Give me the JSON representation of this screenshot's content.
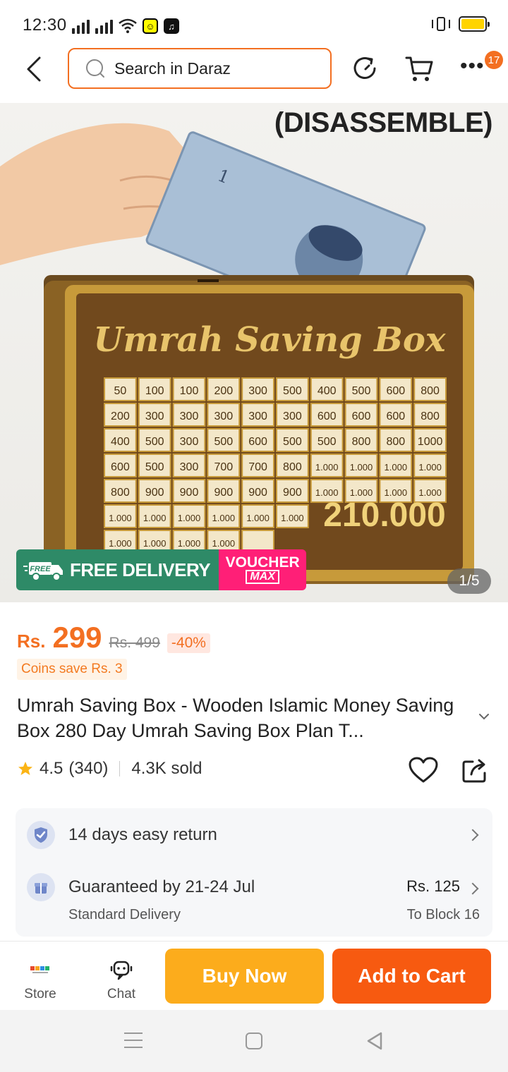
{
  "status_bar": {
    "time": "12:30"
  },
  "header": {
    "search_placeholder": "Search in Daraz",
    "cart_badge": "17"
  },
  "product_image": {
    "overlay_text": "(DISASSEMBLE)",
    "counter": "1/5",
    "promo_free_badge": "FREE",
    "promo_free_delivery": "FREE DELIVERY",
    "promo_voucher_line1": "VOUCHER",
    "promo_voucher_line2": "MAX",
    "box_title": "Umrah Saving Box",
    "box_total": "210.000",
    "box_grid": [
      [
        "50",
        "100",
        "100",
        "200",
        "300",
        "500",
        "400",
        "500",
        "600",
        "800"
      ],
      [
        "200",
        "300",
        "300",
        "300",
        "300",
        "300",
        "600",
        "600",
        "600",
        "800"
      ],
      [
        "400",
        "500",
        "300",
        "500",
        "600",
        "500",
        "500",
        "800",
        "800",
        "1000"
      ],
      [
        "600",
        "500",
        "300",
        "700",
        "700",
        "800",
        "1.000",
        "1.000",
        "1.000",
        "1.000"
      ],
      [
        "800",
        "900",
        "900",
        "900",
        "900",
        "900",
        "1.000",
        "1.000",
        "1.000",
        "1.000"
      ],
      [
        "1.000",
        "1.000",
        "1.000",
        "1.000",
        "1.000",
        "1.000"
      ],
      [
        "1.000",
        "1.000",
        "1.000",
        "1.000",
        ""
      ]
    ]
  },
  "price": {
    "currency": "Rs.",
    "current": "299",
    "original": "Rs. 499",
    "discount": "-40%",
    "coins": "Coins save Rs. 3"
  },
  "product": {
    "title": "Umrah Saving Box - Wooden Islamic Money Saving Box 280 Day Umrah Saving Box Plan T...",
    "rating": "4.5",
    "reviews": "(340)",
    "sold": "4.3K sold"
  },
  "delivery": {
    "return_text": "14 days easy return",
    "guarantee_text": "Guaranteed by 21-24 Jul",
    "delivery_type": "Standard Delivery",
    "delivery_price": "Rs. 125",
    "delivery_to": "To Block 16"
  },
  "actions": {
    "store": "Store",
    "chat": "Chat",
    "buy_now": "Buy Now",
    "add_to_cart": "Add to Cart"
  },
  "colors": {
    "brand": "#f36f21",
    "buy_now": "#fcac1c",
    "add_to_cart": "#f75a10",
    "free_delivery": "#2e8a67",
    "voucher": "#ff1f77"
  }
}
